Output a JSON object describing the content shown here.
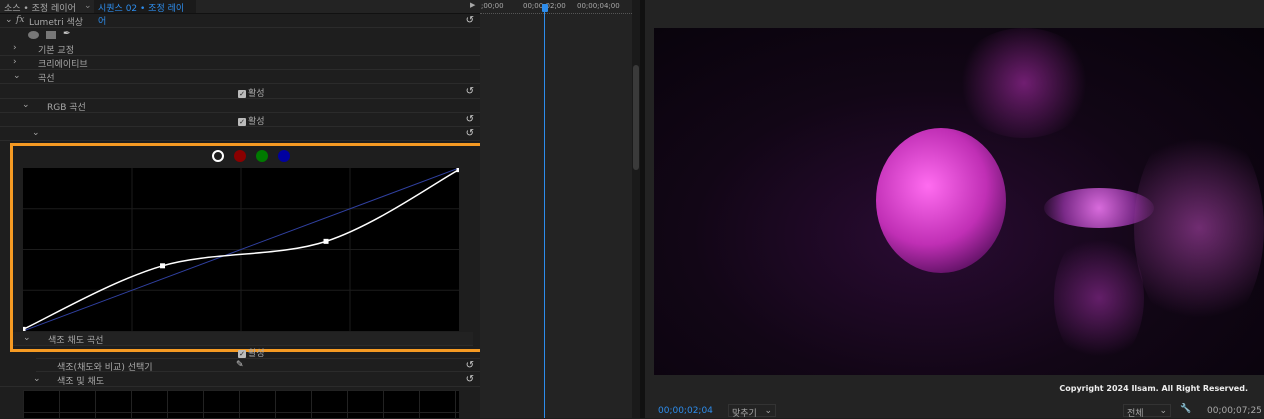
{
  "left_panel": {
    "tab_source": "소스 • 조정 레이어",
    "tab_sequence": "시퀀스 02 • 조정 레이어",
    "effect_name": "Lumetri 색상",
    "fx_label": "fx",
    "sections": [
      "기본 교정",
      "크리에이티브",
      "곡선"
    ],
    "enable_label": "활성",
    "rgb_curve": "RGB 곡선",
    "hue_sat_curve": "색조 채도 곡선",
    "hue_selector": "색조(채도와 비교) 선택기",
    "hue_and_sat": "색조 및 채도"
  },
  "curve": {
    "channels": [
      {
        "name": "white",
        "color": "#ffffff",
        "selected": true
      },
      {
        "name": "red",
        "color": "#8a0000"
      },
      {
        "name": "green",
        "color": "#007a00"
      },
      {
        "name": "blue",
        "color": "#0000a0"
      }
    ],
    "points": [
      [
        0,
        0.01
      ],
      [
        0.32,
        0.4
      ],
      [
        0.695,
        0.55
      ],
      [
        1,
        0.99
      ]
    ],
    "highlight_color": "#f59a23"
  },
  "timeline": {
    "ticks": [
      ";00;00",
      "00;00;02;00",
      "00;00;04;00"
    ],
    "playhead_color": "#2d8ceb"
  },
  "monitor": {
    "copyright": "Copyright 2024 Ilsam. All Right Reserved.",
    "current_time": "00;00;02;04",
    "fit_label": "맞추기",
    "quality_label": "전체",
    "duration": "00;00;07;25"
  }
}
